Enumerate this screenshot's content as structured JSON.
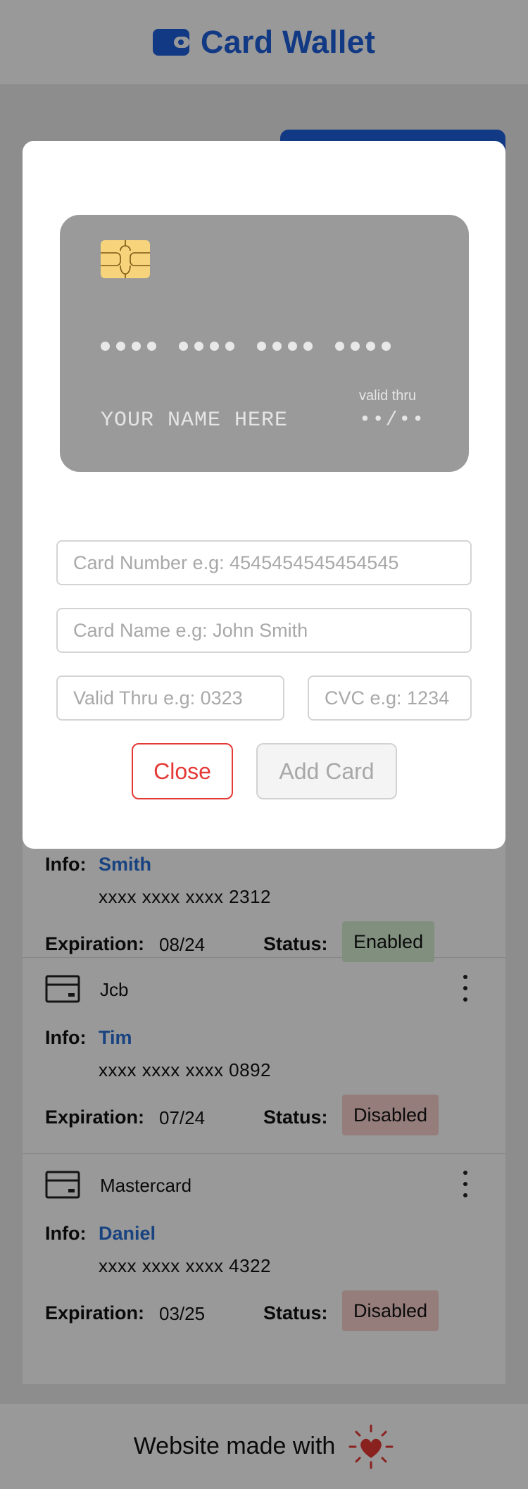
{
  "header": {
    "title": "Card Wallet",
    "icon": "wallet-icon"
  },
  "modal": {
    "card_preview": {
      "number_groups": [
        "••••",
        "••••",
        "••••",
        "••••"
      ],
      "name": "YOUR NAME HERE",
      "valid_label": "valid thru",
      "valid_value": "••/••"
    },
    "fields": {
      "number_placeholder": "Card Number e.g: 4545454545454545",
      "name_placeholder": "Card Name e.g: John Smith",
      "valid_placeholder": "Valid Thru e.g: 0323",
      "cvc_placeholder": "CVC e.g: 1234"
    },
    "close_label": "Close",
    "add_label": "Add Card"
  },
  "labels": {
    "info": "Info:",
    "expiration": "Expiration:",
    "status": "Status:"
  },
  "cards": [
    {
      "type": "",
      "holder": "Smith",
      "number": "xxxx xxxx xxxx 2312",
      "expiration": "08/24",
      "status": "Enabled"
    },
    {
      "type": "Jcb",
      "holder": "Tim",
      "number": "xxxx xxxx xxxx 0892",
      "expiration": "07/24",
      "status": "Disabled"
    },
    {
      "type": "Mastercard",
      "holder": "Daniel",
      "number": "xxxx xxxx xxxx 4322",
      "expiration": "03/25",
      "status": "Disabled"
    }
  ],
  "footer": {
    "text": "Website made with",
    "icon": "heart-icon"
  },
  "colors": {
    "brand": "#1f5fdd",
    "holder": "#2a71d6",
    "close": "#e53935",
    "enabled": "#d6efd2",
    "disabled": "#f9d0cd"
  }
}
